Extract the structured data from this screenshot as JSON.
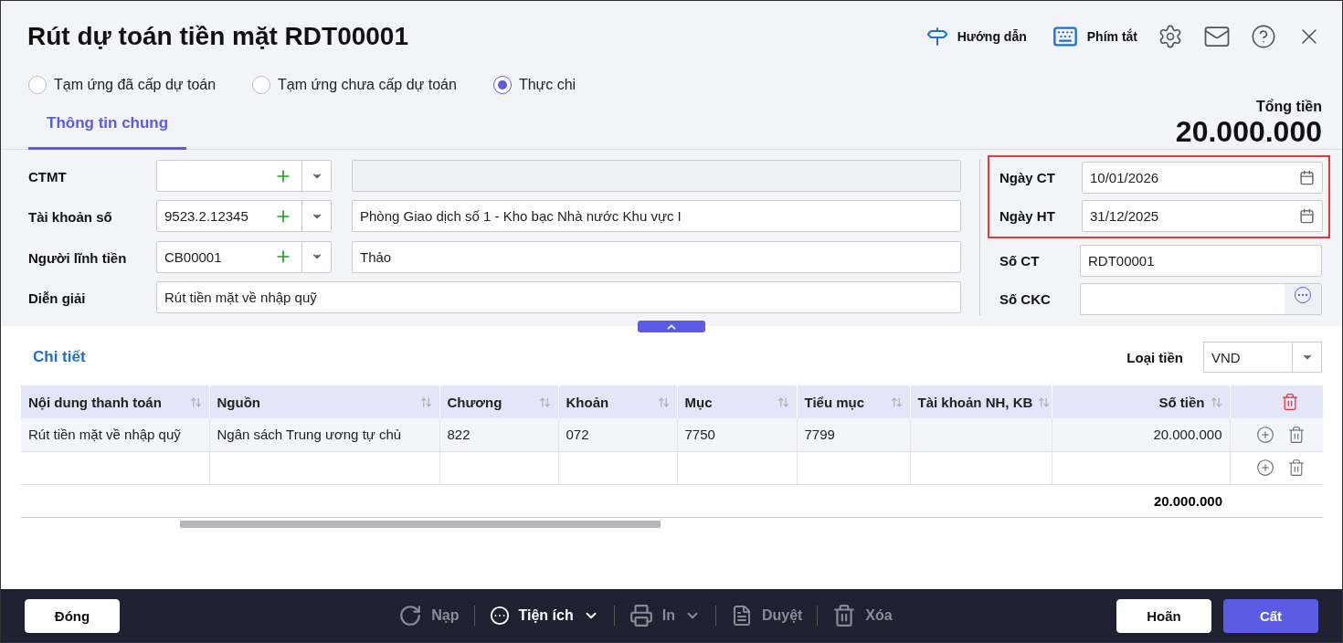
{
  "window": {
    "title": "Rút dự toán tiền mặt RDT00001"
  },
  "header_actions": [
    {
      "kind": "guide",
      "label": "Hướng dẫn"
    },
    {
      "kind": "shortcut",
      "label": "Phím tắt"
    },
    {
      "kind": "settings"
    },
    {
      "kind": "mail"
    },
    {
      "kind": "help"
    },
    {
      "kind": "close"
    }
  ],
  "options": [
    {
      "label": "Tạm ứng đã cấp dự toán",
      "selected": false
    },
    {
      "label": "Tạm ứng chưa cấp dự toán",
      "selected": false
    },
    {
      "label": "Thực chi",
      "selected": true
    }
  ],
  "tabs": [
    {
      "label": "Thông tin chung",
      "selected": true
    }
  ],
  "total": {
    "label": "Tổng tiền",
    "value": "20.000.000"
  },
  "left_fields": [
    {
      "kind": "combo",
      "label": "CTMT"
    },
    {
      "kind": "combo",
      "label": "Tài khoản số",
      "value": "9523.2.12345",
      "name": "Phòng Giao dịch số 1 - Kho bạc Nhà nước Khu vực I"
    },
    {
      "kind": "combo",
      "label": "Người lĩnh tiền",
      "value": "CB00001",
      "name": "Thảo"
    },
    {
      "kind": "text",
      "label": "Diễn giải",
      "value": "Rút tiền mặt về nhập quỹ"
    }
  ],
  "right_fields": [
    {
      "kind": "date",
      "label": "Ngày CT",
      "value": "10/01/2026",
      "highlighted": true
    },
    {
      "kind": "date",
      "label": "Ngày HT",
      "value": "31/12/2025",
      "highlighted": true
    },
    {
      "kind": "text",
      "label": "Số CT",
      "value": "RDT00001",
      "highlighted": false
    },
    {
      "kind": "more",
      "label": "Số CKC",
      "highlighted": false
    }
  ],
  "detail": {
    "title": "Chi tiết",
    "currency_label": "Loại tiền",
    "currency": "VND"
  },
  "table": {
    "columns": [
      "Nội dung thanh toán",
      "Nguồn",
      "Chương",
      "Khoản",
      "Mục",
      "Tiểu mục",
      "Tài khoản NH, KB",
      "Số tiền"
    ],
    "rows": [
      [
        "Rút tiền mặt về nhập quỹ",
        "Ngân sách Trung ương tự chủ",
        "822",
        "072",
        "7750",
        "7799",
        "",
        "20.000.000"
      ],
      [
        "",
        "",
        "",
        "",
        "",
        "",
        "",
        ""
      ]
    ],
    "total": "20.000.000"
  },
  "footer": {
    "close": "Đóng",
    "tools": [
      {
        "kind": "reload",
        "label": "Nạp",
        "disabled": true
      },
      {
        "kind": "utility",
        "label": "Tiện ích",
        "disabled": false
      },
      {
        "kind": "print",
        "label": "In",
        "disabled": true
      },
      {
        "kind": "approve",
        "label": "Duyệt",
        "disabled": true
      },
      {
        "kind": "delete",
        "label": "Xóa",
        "disabled": true
      }
    ],
    "cancel": "Hoãn",
    "save": "Cất"
  }
}
